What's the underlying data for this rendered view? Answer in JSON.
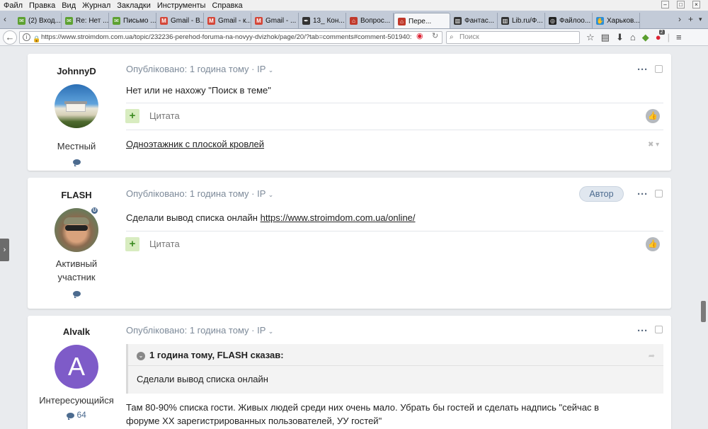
{
  "menu": [
    "Файл",
    "Правка",
    "Вид",
    "Журнал",
    "Закладки",
    "Инструменты",
    "Справка"
  ],
  "tabs": [
    {
      "label": "(2) Вход...",
      "icon": "envelope-icon",
      "color": "#5da131"
    },
    {
      "label": "Re: Нет ...",
      "icon": "envelope-icon",
      "color": "#5da131"
    },
    {
      "label": "Письмо ...",
      "icon": "envelope-icon",
      "color": "#5da131"
    },
    {
      "label": "Gmail - В...",
      "icon": "gmail-icon",
      "color": "#d44638"
    },
    {
      "label": "Gmail - к...",
      "icon": "gmail-icon",
      "color": "#d44638"
    },
    {
      "label": "Gmail - ...",
      "icon": "gmail-icon",
      "color": "#d44638"
    },
    {
      "label": "13_ Кон...",
      "icon": "quill-icon",
      "color": "#333333"
    },
    {
      "label": "Вопрос...",
      "icon": "house-icon",
      "color": "#c0392b"
    },
    {
      "label": "Пере...",
      "icon": "house-icon",
      "color": "#c0392b",
      "active": true
    },
    {
      "label": "Фантас...",
      "icon": "bookshelf-icon",
      "color": "#333333"
    },
    {
      "label": "Lib.ru/Ф...",
      "icon": "bookshelf-icon",
      "color": "#333333"
    },
    {
      "label": "Файлоо...",
      "icon": "globe-icon",
      "color": "#222222"
    },
    {
      "label": "Харьков...",
      "icon": "hand-icon",
      "color": "#2d8fd6"
    }
  ],
  "nav": {
    "url": "https://www.stroimdom.com.ua/topic/232236-perehod-foruma-na-novyy-dvizhok/page/20/?tab=comments#comment-501940:",
    "search_placeholder": "Поиск",
    "notif_count": "2"
  },
  "posts": [
    {
      "author": "JohnnyD",
      "role": "Местный",
      "meta": "Опубліковано: 1 година тому · IP",
      "text": "Нет или не нахожу \"Поиск в теме\"",
      "quote_label": "Цитата",
      "signature": "Одноэтажник с плоской кровлей",
      "avatar": "photo"
    },
    {
      "author": "FLASH",
      "role_line1": "Активный",
      "role_line2": "участник",
      "meta": "Опубліковано: 1 година тому · IP",
      "badge": "Автор",
      "text_prefix": "Сделали вывод списка онлайн ",
      "link": "https://www.stroimdom.com.ua/online/",
      "quote_label": "Цитата",
      "online_badge": "U"
    },
    {
      "author": "Alvalk",
      "avatar_letter": "A",
      "avatar_color": "#7e5bc8",
      "role": "Интересующийся",
      "comment_count": "64",
      "meta": "Опубліковано: 1 година тому · IP",
      "quote_head": "1 година тому, FLASH сказав:",
      "quote_body": "Сделали вывод списка онлайн",
      "text_line1": "Там 80-90% списка гости. Живых людей среди них очень мало. Убрать бы гостей  и сделать надпись \"сейчас в",
      "text_line2": "форуме ХХ зарегистрированных пользователей, УУ гостей\""
    }
  ]
}
